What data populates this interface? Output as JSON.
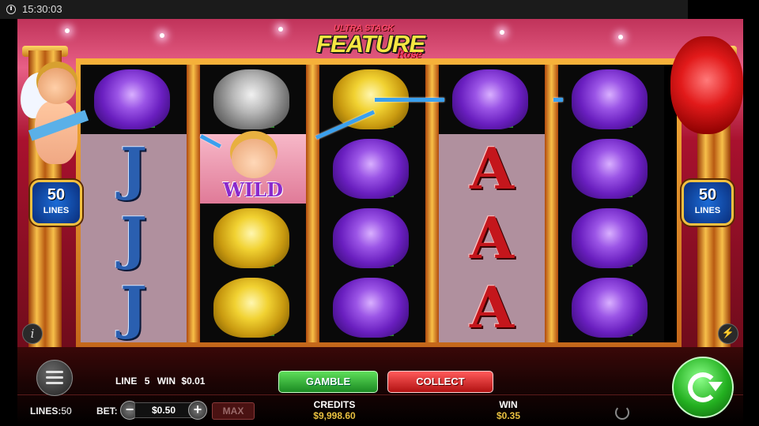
{
  "status_bar": {
    "time": "15:30:03"
  },
  "logo": {
    "line1": "ULTRA STACK",
    "line2": "FEATURE",
    "line3": "Rose"
  },
  "badges": {
    "left": {
      "number": "50",
      "label": "LINES"
    },
    "right": {
      "number": "50",
      "label": "LINES"
    }
  },
  "reels": [
    [
      "purple-rose",
      "J",
      "J",
      "J"
    ],
    [
      "gray-rose",
      "WILD",
      "yellow-rose",
      "yellow-rose"
    ],
    [
      "yellow-rose",
      "purple-rose",
      "purple-rose",
      "purple-rose"
    ],
    [
      "purple-rose",
      "A",
      "A",
      "A"
    ],
    [
      "purple-rose",
      "purple-rose",
      "purple-rose",
      "purple-rose"
    ]
  ],
  "symbols": {
    "wild": "WILD",
    "j": "J",
    "a": "A"
  },
  "controls": {
    "info_icon": "i",
    "line_label": "LINE",
    "line_number": "5",
    "win_label": "WIN",
    "line_win": "$0.01",
    "gamble": "GAMBLE",
    "collect": "COLLECT",
    "lines_label": "LINES:",
    "lines_value": "50",
    "bet_label": "BET:",
    "bet_value": "$0.50",
    "minus": "−",
    "plus": "+",
    "max": "MAX",
    "credits_label": "CREDITS",
    "credits_value": "$9,998.60",
    "total_win_label": "WIN",
    "total_win_value": "$0.35"
  },
  "colors": {
    "accent_green": "#23b020",
    "accent_red": "#b11212",
    "payline": "#3aa0ee",
    "gold": "#f7c04a"
  }
}
